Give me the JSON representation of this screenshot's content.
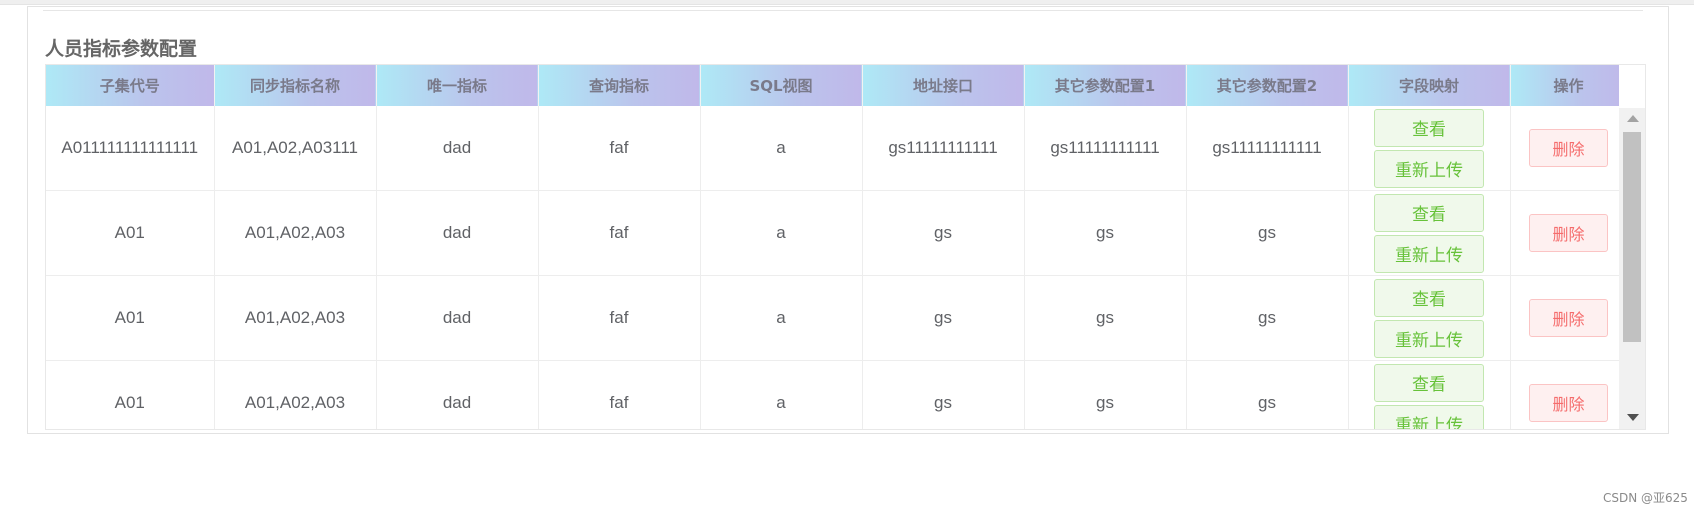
{
  "title": "人员指标参数配置",
  "columns": [
    "子集代号",
    "同步指标名称",
    "唯一指标",
    "查询指标",
    "SQL视图",
    "地址接口",
    "其它参数配置1",
    "其它参数配置2",
    "字段映射",
    "操作"
  ],
  "rows": [
    {
      "subset": "A011111111111111",
      "sync_name": "A01,A02,A03111",
      "unique": "dad",
      "query": "faf",
      "sql_view": "a",
      "address": "gs11111111111",
      "other1": "gs11111111111",
      "other2": "gs11111111111"
    },
    {
      "subset": "A01",
      "sync_name": "A01,A02,A03",
      "unique": "dad",
      "query": "faf",
      "sql_view": "a",
      "address": "gs",
      "other1": "gs",
      "other2": "gs"
    },
    {
      "subset": "A01",
      "sync_name": "A01,A02,A03",
      "unique": "dad",
      "query": "faf",
      "sql_view": "a",
      "address": "gs",
      "other1": "gs",
      "other2": "gs"
    },
    {
      "subset": "A01",
      "sync_name": "A01,A02,A03",
      "unique": "dad",
      "query": "faf",
      "sql_view": "a",
      "address": "gs",
      "other1": "gs",
      "other2": "gs"
    }
  ],
  "buttons": {
    "view": "查看",
    "reupload": "重新上传",
    "delete": "删除"
  },
  "watermark": "CSDN @亚625",
  "colors": {
    "header_start": "#aee9f6",
    "header_end": "#c0b8ea",
    "success": "#67c23a",
    "danger": "#f56c6c"
  }
}
